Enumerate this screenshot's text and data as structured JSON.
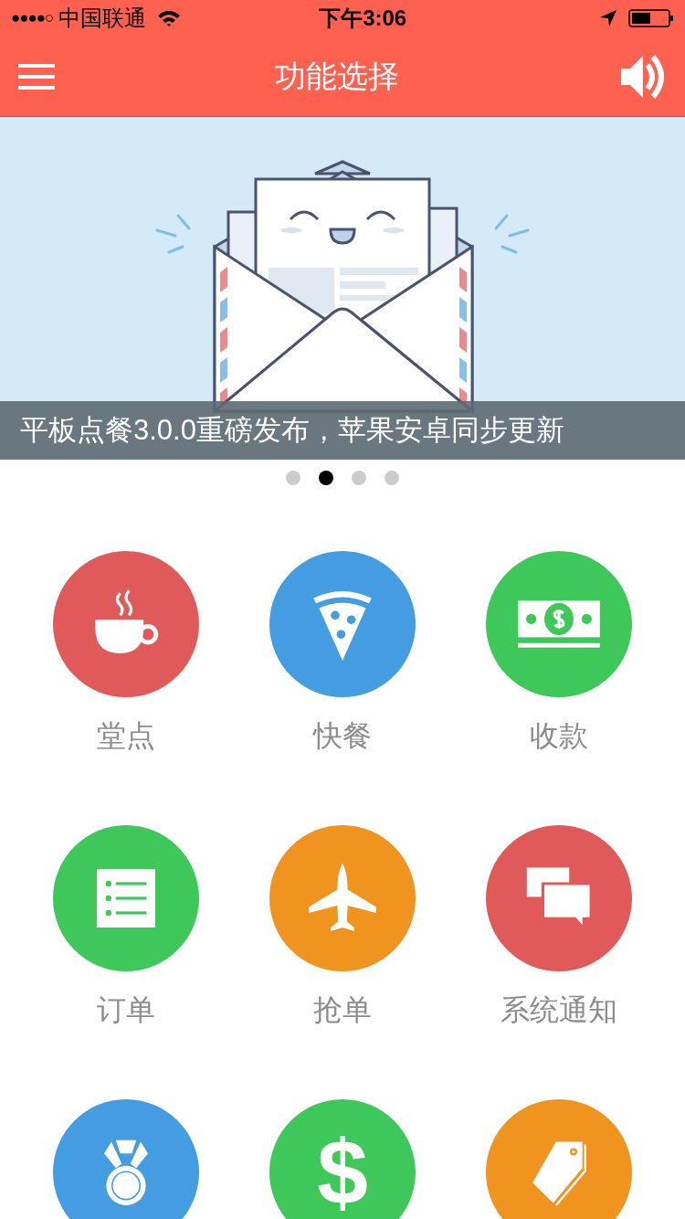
{
  "status_bar": {
    "signal": "●●●●○",
    "carrier": "中国联通",
    "time": "下午3:06"
  },
  "nav": {
    "title": "功能选择"
  },
  "banner": {
    "caption": "平板点餐3.0.0重磅发布，苹果安卓同步更新",
    "pages": [
      {
        "selected": false
      },
      {
        "selected": true
      },
      {
        "selected": false
      },
      {
        "selected": false
      }
    ]
  },
  "features": [
    {
      "kind": "cup",
      "label": "堂点",
      "color": "#e05a5a"
    },
    {
      "kind": "pizza",
      "label": "快餐",
      "color": "#439de0"
    },
    {
      "kind": "cash",
      "label": "收款",
      "color": "#3ec85a"
    },
    {
      "kind": "list",
      "label": "订单",
      "color": "#3ec85a"
    },
    {
      "kind": "plane",
      "label": "抢单",
      "color": "#f0931f"
    },
    {
      "kind": "chat",
      "label": "系统通知",
      "color": "#e05a5a"
    },
    {
      "kind": "medal",
      "color": "#439de0"
    },
    {
      "kind": "dollar",
      "glyph": "$",
      "color": "#3ec85a"
    },
    {
      "kind": "tag",
      "color": "#f0931f"
    }
  ]
}
